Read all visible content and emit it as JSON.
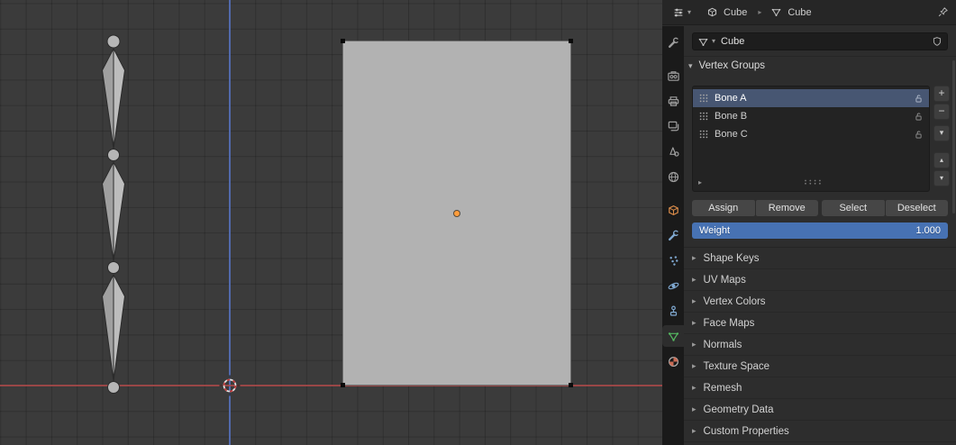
{
  "header": {
    "editor": "properties-editor",
    "breadcrumb": {
      "object": "Cube",
      "mesh": "Cube"
    }
  },
  "datablock": {
    "name": "Cube"
  },
  "vertex_groups": {
    "title": "Vertex Groups",
    "items": [
      {
        "name": "Bone A",
        "selected": true
      },
      {
        "name": "Bone B",
        "selected": false
      },
      {
        "name": "Bone C",
        "selected": false
      }
    ],
    "actions": {
      "assign": "Assign",
      "remove": "Remove",
      "select": "Select",
      "deselect": "Deselect"
    },
    "weight": {
      "label": "Weight",
      "value": "1.000"
    }
  },
  "panels": [
    "Shape Keys",
    "UV Maps",
    "Vertex Colors",
    "Face Maps",
    "Normals",
    "Texture Space",
    "Remesh",
    "Geometry Data",
    "Custom Properties"
  ],
  "tabs": [
    "tool",
    "render",
    "output",
    "view-layer",
    "scene",
    "world",
    "object",
    "modifiers",
    "particles",
    "physics",
    "constraints",
    "object-data",
    "material"
  ],
  "active_tab": "object-data",
  "glyphs": {
    "expanded": "▾",
    "collapsed": "▸",
    "plus": "+",
    "minus": "−",
    "chevron_down": "▾",
    "up": "▴",
    "down": "▾",
    "breadcrumb_sep": "▸"
  },
  "colors": {
    "accent_slider": "#4772b3",
    "selected_row": "#475672",
    "axis_x": "#ac4a4a",
    "axis_z": "#5570b9",
    "object_icon": "#d98b49",
    "data_icon": "#55b860",
    "material_icon": "#c96c55",
    "modifier_icon": "#7fa8d0"
  }
}
